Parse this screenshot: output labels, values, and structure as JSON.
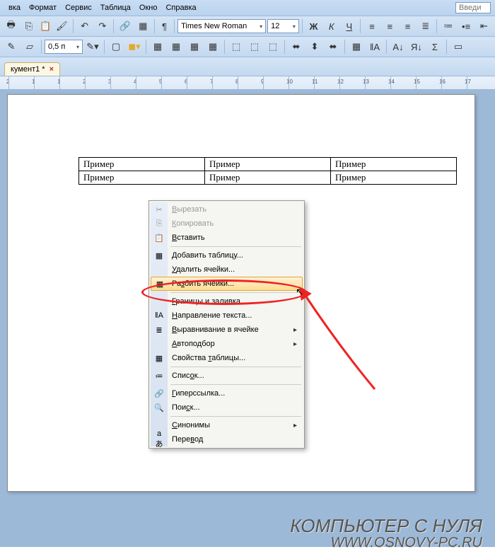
{
  "menu": {
    "items": [
      "вка",
      "Формат",
      "Сервис",
      "Таблица",
      "Окно",
      "Справка"
    ],
    "accel": [
      0,
      2,
      0,
      0,
      0,
      1
    ],
    "search_placeholder": "Введи"
  },
  "toolbar": {
    "font": "Times New Roman",
    "size": "12",
    "lineheight": "0,5 п",
    "bold": "Ж",
    "italic": "К",
    "underline": "Ч"
  },
  "tab": {
    "label": "кумент1 *"
  },
  "ruler": {
    "marks": [
      "2",
      "1",
      "1",
      "2",
      "3",
      "4",
      "5",
      "6",
      "7",
      "8",
      "9",
      "10",
      "11",
      "12",
      "13",
      "14",
      "15",
      "16",
      "17"
    ]
  },
  "table": {
    "rows": [
      [
        "Пример",
        "Пример",
        "Пример"
      ],
      [
        "Пример",
        "Пример",
        "Пример"
      ]
    ]
  },
  "context_menu": {
    "items": [
      {
        "label": "Вырезать",
        "accel": 0,
        "icon": "✂",
        "disabled": true
      },
      {
        "label": "Копировать",
        "accel": 0,
        "icon": "⎘",
        "disabled": true
      },
      {
        "label": "Вставить",
        "accel": 0,
        "icon": "📋"
      },
      {
        "sep": true
      },
      {
        "label": "Добавить таблицу...",
        "accel": 0,
        "icon": "▦"
      },
      {
        "label": "Удалить ячейки...",
        "accel": 0
      },
      {
        "label": "Разбить ячейки...",
        "accel": 2,
        "icon": "▦",
        "hover": true
      },
      {
        "sep": true
      },
      {
        "label": "Границы и заливка...",
        "accel": 0
      },
      {
        "label": "Направление текста...",
        "accel": 0,
        "icon": "‖А"
      },
      {
        "label": "Выравнивание в ячейке",
        "accel": 0,
        "icon": "≣",
        "submenu": true
      },
      {
        "label": "Автоподбор",
        "accel": 0,
        "submenu": true
      },
      {
        "label": "Свойства таблицы...",
        "accel": 9,
        "icon": "▦"
      },
      {
        "sep": true
      },
      {
        "label": "Список...",
        "accel": 4,
        "icon": "≔"
      },
      {
        "sep": true
      },
      {
        "label": "Гиперссылка...",
        "accel": 0,
        "icon": "🔗"
      },
      {
        "label": "Поиск...",
        "accel": 3,
        "icon": "🔍"
      },
      {
        "sep": true
      },
      {
        "label": "Синонимы",
        "accel": 0,
        "submenu": true
      },
      {
        "label": "Перевод",
        "accel": 4,
        "icon": "aあ"
      }
    ]
  },
  "watermark": {
    "line1": "КОМПЬЮТЕР С НУЛЯ",
    "line2": "WWW.OSNOVY-PC.RU"
  }
}
